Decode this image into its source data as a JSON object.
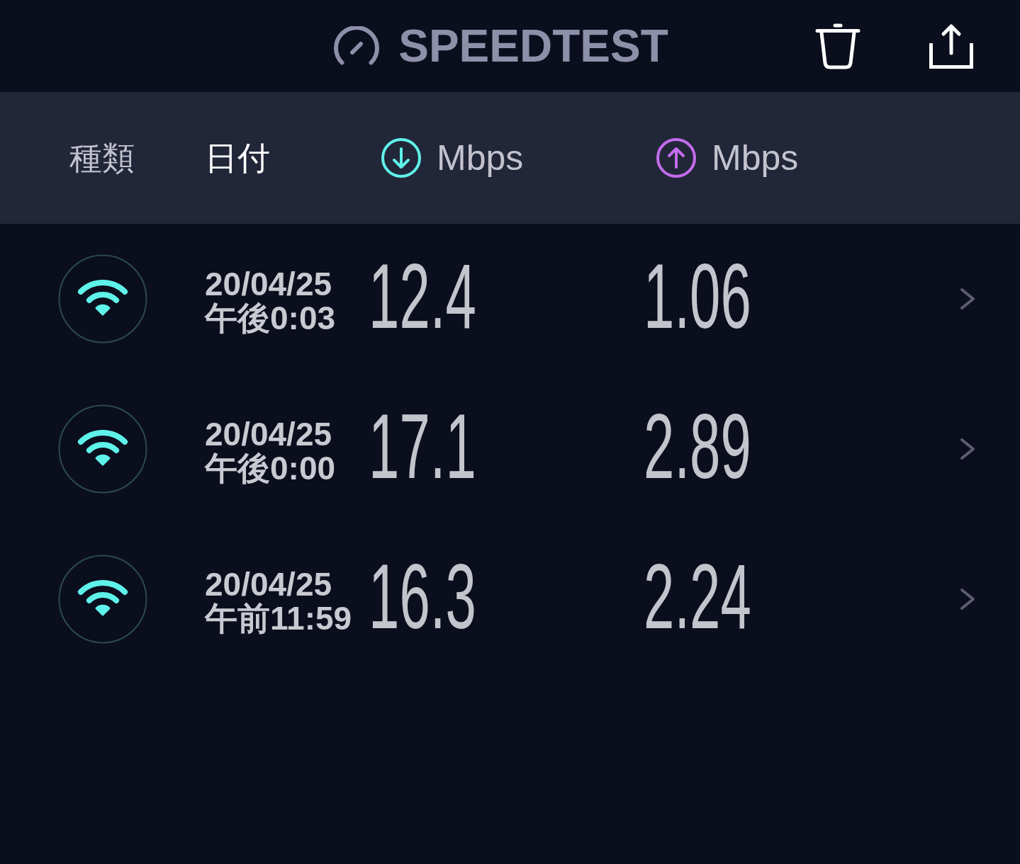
{
  "header": {
    "title": "SPEEDTEST"
  },
  "columns": [
    {
      "label": "種類",
      "kind": "text",
      "selected": false
    },
    {
      "label": "日付",
      "kind": "text",
      "selected": true
    },
    {
      "label": "Mbps",
      "kind": "download",
      "selected": false
    },
    {
      "label": "Mbps",
      "kind": "upload",
      "selected": false
    }
  ],
  "results": [
    {
      "kind": "wifi",
      "date": "20/04/25",
      "time": "午後0:03",
      "download": "12.4",
      "upload": "1.06"
    },
    {
      "kind": "wifi",
      "date": "20/04/25",
      "time": "午後0:00",
      "download": "17.1",
      "upload": "2.89"
    },
    {
      "kind": "wifi",
      "date": "20/04/25",
      "time": "午前11:59",
      "download": "16.3",
      "upload": "2.24"
    }
  ]
}
